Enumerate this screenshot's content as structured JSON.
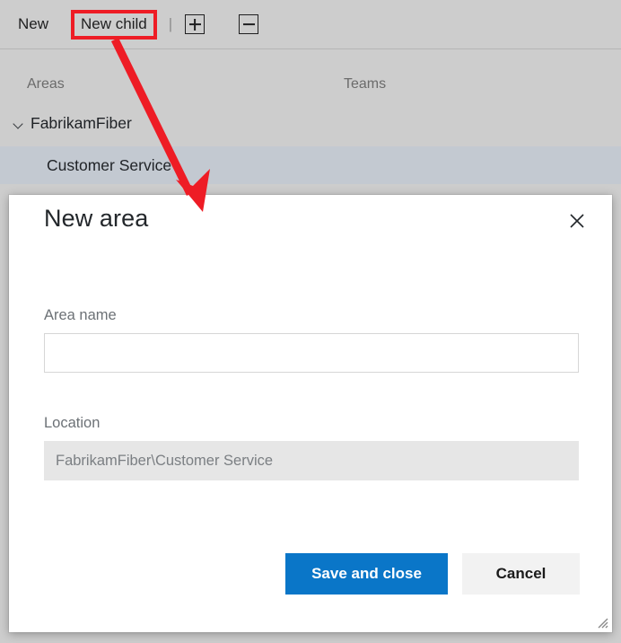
{
  "toolbar": {
    "new_label": "New",
    "new_child_label": "New child",
    "separator": "|",
    "expand_all_icon": "plus-box-icon",
    "collapse_all_icon": "minus-box-icon"
  },
  "columns": {
    "areas_header": "Areas",
    "teams_header": "Teams"
  },
  "tree": {
    "root": {
      "label": "FabrikamFiber",
      "chevron_icon": "chevron-down-icon"
    },
    "child": {
      "label": "Customer Service",
      "selected": true
    }
  },
  "dialog": {
    "title": "New area",
    "close_icon": "close-icon",
    "area_name": {
      "label": "Area name",
      "value": "",
      "placeholder": ""
    },
    "location": {
      "label": "Location",
      "value": "FabrikamFiber\\Customer Service",
      "readonly": true
    },
    "save_label": "Save and close",
    "cancel_label": "Cancel",
    "resize_grip_icon": "resize-grip-icon"
  },
  "annotations": {
    "highlight_target": "New child",
    "arrow_color": "#ee1c25",
    "arrow_from": "New child button",
    "arrow_to": "New area dialog"
  },
  "colors": {
    "accent": "#0a76c8",
    "annotation_red": "#ee1c25",
    "page_background": "#cdcdcd",
    "row_selected": "#c3c9d1",
    "dialog_background": "#ffffff",
    "readonly_field": "#e6e6e6"
  }
}
